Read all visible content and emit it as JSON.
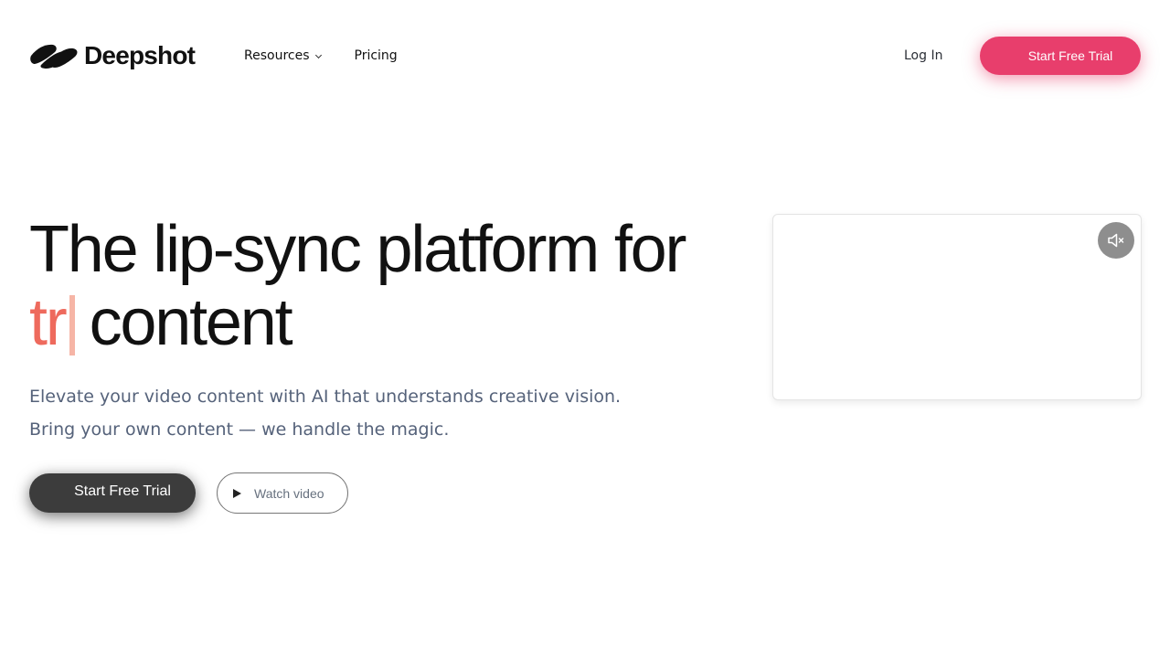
{
  "header": {
    "brand": "Deepshot",
    "logo_icon": "deepshot-logo-icon",
    "nav": [
      {
        "label": "Resources",
        "icon": "chevron-down-icon"
      },
      {
        "label": "Pricing"
      }
    ],
    "login_label": "Log In",
    "cta_label": "Start Free Trial"
  },
  "hero": {
    "title_line1": "The lip-sync platform for",
    "title_typed": "tr",
    "title_line2_rest": "content",
    "subtitle_line1": "Elevate your video content with AI that understands creative vision.",
    "subtitle_line2": "Bring your own content — we handle the magic.",
    "cta_label": "Start Free Trial",
    "watch_label": "Watch video",
    "watch_icon": "play-icon"
  },
  "video": {
    "mute_icon": "speaker-muted-icon"
  },
  "colors": {
    "accent": "#e83e6c",
    "typed_text": "#ee6a5d",
    "caret": "#f6b5a6",
    "dark_button": "#3c3c3c",
    "subtitle": "#55627a"
  }
}
